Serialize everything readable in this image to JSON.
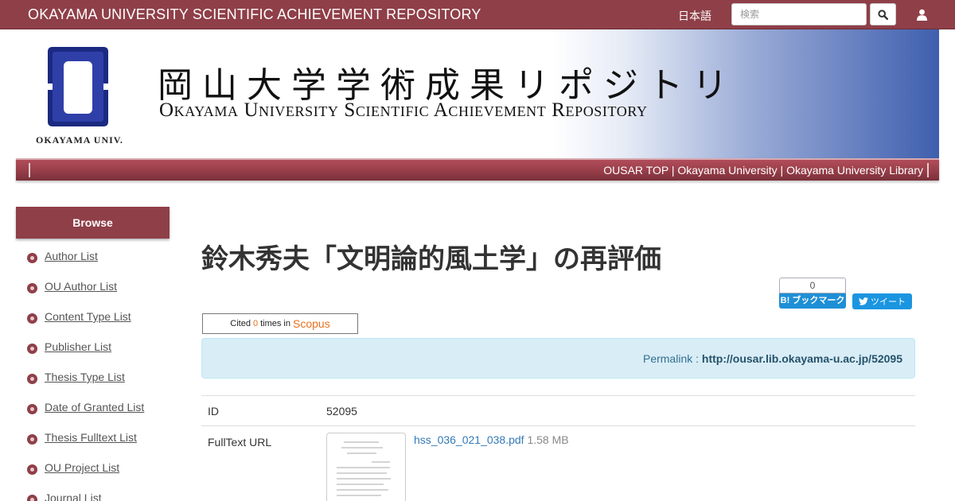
{
  "header": {
    "site_title": "OKAYAMA UNIVERSITY SCIENTIFIC ACHIEVEMENT REPOSITORY",
    "language_link": "日本語",
    "search_placeholder": "検索",
    "search_icon": "search-icon",
    "user_icon": "user-icon"
  },
  "banner": {
    "logo_caption": "OKAYAMA UNIV.",
    "title_jp": "岡山大学学術成果リポジトリ",
    "title_en": "Okayama University Scientific Achievement Repository",
    "logo_colors": {
      "blue": "#2f3fa8",
      "frame": "#1b2a80"
    }
  },
  "subnav": {
    "links": [
      "OUSAR TOP",
      "Okayama University",
      "Okayama University Library"
    ],
    "separator": " | "
  },
  "sidebar": {
    "heading": "Browse",
    "items": [
      "Author List",
      "OU Author List",
      "Content Type List",
      "Publisher List",
      "Thesis Type List",
      "Date of Granted List",
      "Thesis Fulltext List",
      "OU Project List",
      "Journal List"
    ]
  },
  "main": {
    "title": "鈴木秀夫「文明論的風土学」の再評価",
    "hatena": {
      "count": "0",
      "label": "B! ブックマーク"
    },
    "tweet_label": "ツイート",
    "scopus": {
      "prefix": "Cited",
      "count": "0",
      "middle": "times in",
      "brand": "Scopus"
    },
    "permalink": {
      "label": "Permalink : ",
      "url": "http://ousar.lib.okayama-u.ac.jp/52095"
    },
    "table": [
      {
        "label": "ID",
        "value": "52095"
      },
      {
        "label": "FullText URL",
        "file_name": "hss_036_021_038.pdf",
        "file_size": "1.58 MB"
      }
    ]
  },
  "colors": {
    "brand": "#8f3f48",
    "permalink_bg": "#d9edf7",
    "hatena": "#1e8fd6",
    "twitter": "#1b95e0",
    "scopus": "#e9711c"
  }
}
